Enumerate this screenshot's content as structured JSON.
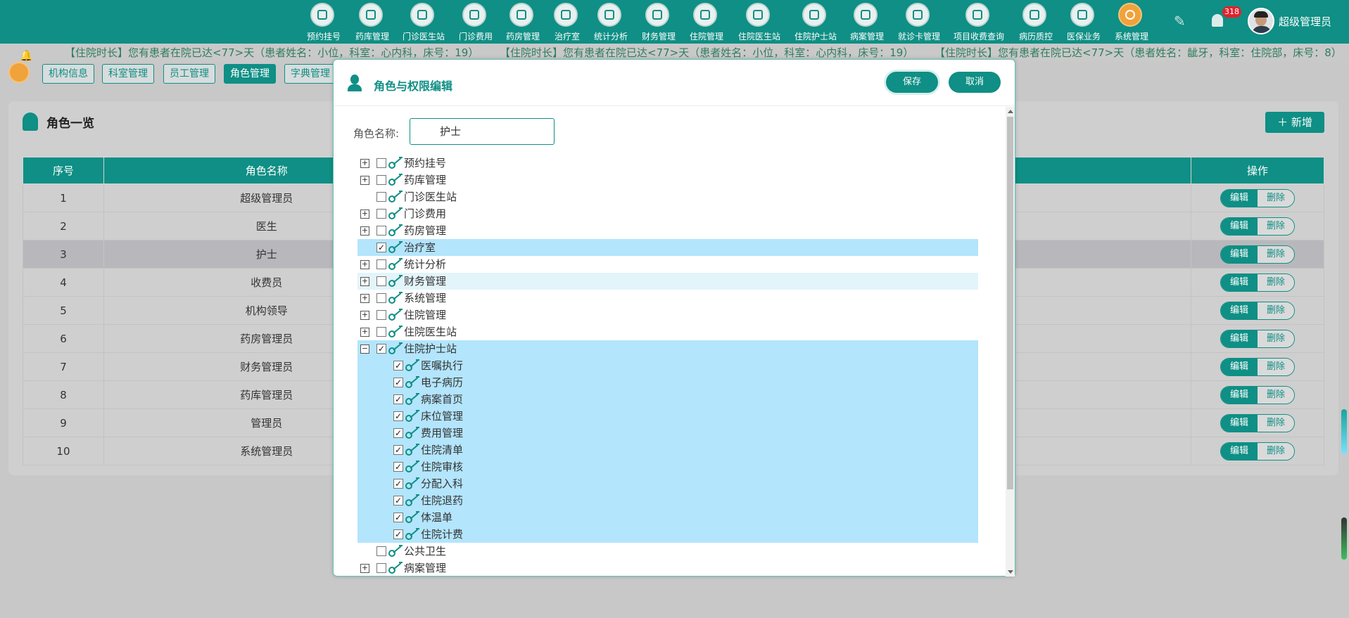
{
  "header": {
    "nav": [
      {
        "label": "预约挂号",
        "icon": "calendar-icon"
      },
      {
        "label": "药库管理",
        "icon": "warehouse-icon"
      },
      {
        "label": "门诊医生站",
        "icon": "doctor-icon"
      },
      {
        "label": "门诊费用",
        "icon": "yen-icon"
      },
      {
        "label": "药房管理",
        "icon": "pill-icon"
      },
      {
        "label": "治疗室",
        "icon": "nurse-icon"
      },
      {
        "label": "统计分析",
        "icon": "bar-chart-icon"
      },
      {
        "label": "财务管理",
        "icon": "gear-icon"
      },
      {
        "label": "住院管理",
        "icon": "bed-icon"
      },
      {
        "label": "住院医生站",
        "icon": "id-card-icon"
      },
      {
        "label": "住院护士站",
        "icon": "id-card-icon"
      },
      {
        "label": "病案管理",
        "icon": "document-icon"
      },
      {
        "label": "就诊卡管理",
        "icon": "card-icon"
      },
      {
        "label": "项目收费查询",
        "icon": "invoice-icon"
      },
      {
        "label": "病历质控",
        "icon": "clipboard-icon"
      },
      {
        "label": "医保业务",
        "icon": "insurance-icon"
      },
      {
        "label": "系统管理",
        "icon": "settings-icon"
      }
    ],
    "notification_count": "318",
    "username": "超级管理员"
  },
  "marquee": [
    "【住院时长】您有患者在院已达<77>天（患者姓名：小位，科室：心内科，床号：19）",
    "【住院时长】您有患者在院已达<77>天（患者姓名：小位，科室：心内科，床号：19）",
    "【住院时长】您有患者在院已达<77>天（患者姓名：龇牙，科室：住院部，床号：8）"
  ],
  "tabs": [
    "机构信息",
    "科室管理",
    "员工管理",
    "角色管理",
    "字典管理"
  ],
  "active_tab": "角色管理",
  "panel": {
    "title": "角色一览",
    "add_label": "新增",
    "columns": [
      "序号",
      "角色名称",
      "",
      "操作"
    ],
    "edit_label": "编辑",
    "delete_label": "删除",
    "rows": [
      {
        "no": "1",
        "name": "超级管理员"
      },
      {
        "no": "2",
        "name": "医生"
      },
      {
        "no": "3",
        "name": "护士"
      },
      {
        "no": "4",
        "name": "收费员"
      },
      {
        "no": "5",
        "name": "机构领导"
      },
      {
        "no": "6",
        "name": "药房管理员"
      },
      {
        "no": "7",
        "name": "财务管理员"
      },
      {
        "no": "8",
        "name": "药库管理员"
      },
      {
        "no": "9",
        "name": "管理员"
      },
      {
        "no": "10",
        "name": "系统管理员"
      }
    ],
    "selected_row": "3"
  },
  "modal": {
    "title": "角色与权限编辑",
    "save_label": "保存",
    "cancel_label": "取消",
    "role_name_label": "角色名称:",
    "role_name_value": "护士",
    "tree": [
      {
        "label": "预约挂号",
        "level": 0,
        "expander": "plus",
        "checked": false,
        "highlight": ""
      },
      {
        "label": "药库管理",
        "level": 0,
        "expander": "plus",
        "checked": false,
        "highlight": ""
      },
      {
        "label": "门诊医生站",
        "level": 0,
        "expander": "",
        "checked": false,
        "highlight": ""
      },
      {
        "label": "门诊费用",
        "level": 0,
        "expander": "plus",
        "checked": false,
        "highlight": ""
      },
      {
        "label": "药房管理",
        "level": 0,
        "expander": "plus",
        "checked": false,
        "highlight": ""
      },
      {
        "label": "治疗室",
        "level": 0,
        "expander": "",
        "checked": true,
        "highlight": "selected"
      },
      {
        "label": "统计分析",
        "level": 0,
        "expander": "plus",
        "checked": false,
        "highlight": ""
      },
      {
        "label": "财务管理",
        "level": 0,
        "expander": "plus",
        "checked": false,
        "highlight": "hover"
      },
      {
        "label": "系统管理",
        "level": 0,
        "expander": "plus",
        "checked": false,
        "highlight": ""
      },
      {
        "label": "住院管理",
        "level": 0,
        "expander": "plus",
        "checked": false,
        "highlight": ""
      },
      {
        "label": "住院医生站",
        "level": 0,
        "expander": "plus",
        "checked": false,
        "highlight": ""
      },
      {
        "label": "住院护士站",
        "level": 0,
        "expander": "minus",
        "checked": true,
        "highlight": "selected"
      },
      {
        "label": "医嘱执行",
        "level": 1,
        "expander": "",
        "checked": true,
        "highlight": "selected"
      },
      {
        "label": "电子病历",
        "level": 1,
        "expander": "",
        "checked": true,
        "highlight": "selected"
      },
      {
        "label": "病案首页",
        "level": 1,
        "expander": "",
        "checked": true,
        "highlight": "selected"
      },
      {
        "label": "床位管理",
        "level": 1,
        "expander": "",
        "checked": true,
        "highlight": "selected"
      },
      {
        "label": "费用管理",
        "level": 1,
        "expander": "",
        "checked": true,
        "highlight": "selected"
      },
      {
        "label": "住院清单",
        "level": 1,
        "expander": "",
        "checked": true,
        "highlight": "selected"
      },
      {
        "label": "住院审核",
        "level": 1,
        "expander": "",
        "checked": true,
        "highlight": "selected"
      },
      {
        "label": "分配入科",
        "level": 1,
        "expander": "",
        "checked": true,
        "highlight": "selected"
      },
      {
        "label": "住院退药",
        "level": 1,
        "expander": "",
        "checked": true,
        "highlight": "selected"
      },
      {
        "label": "体温单",
        "level": 1,
        "expander": "",
        "checked": true,
        "highlight": "selected"
      },
      {
        "label": "住院计费",
        "level": 1,
        "expander": "",
        "checked": true,
        "highlight": "selected"
      },
      {
        "label": "公共卫生",
        "level": 0,
        "expander": "",
        "checked": false,
        "highlight": ""
      },
      {
        "label": "病案管理",
        "level": 0,
        "expander": "plus",
        "checked": false,
        "highlight": ""
      }
    ]
  },
  "colors": {
    "primary": "#0f8f85",
    "highlight": "#b3e5fc",
    "accent": "#f0a23b"
  }
}
